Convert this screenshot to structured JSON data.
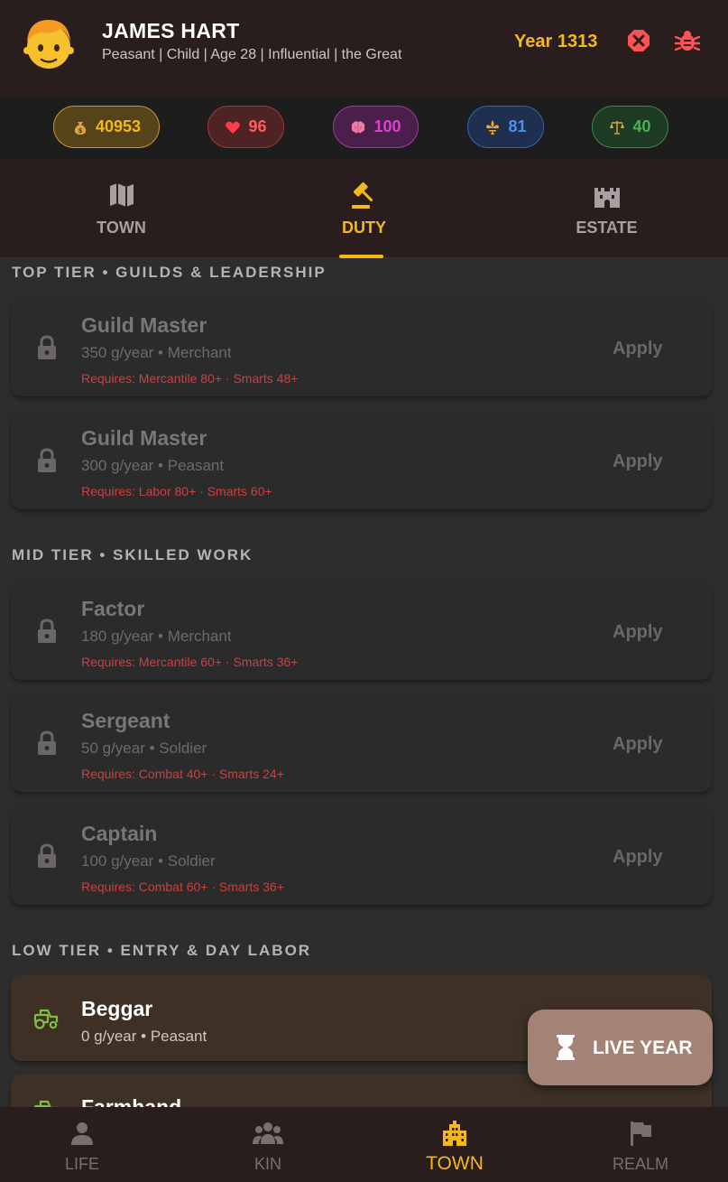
{
  "header": {
    "name": "JAMES HART",
    "subtitle": "Peasant | Child | Age 28 | Influential | the Great",
    "year": "Year 1313"
  },
  "stats": [
    {
      "icon": "money-bag-icon",
      "value": "40953",
      "color": "#f5b81c"
    },
    {
      "icon": "heart-icon",
      "value": "96",
      "color": "#ff5c5c"
    },
    {
      "icon": "brain-icon",
      "value": "100",
      "color": "#e53cd7"
    },
    {
      "icon": "fleur-de-lis-icon",
      "value": "81",
      "color": "#4e8ff0"
    },
    {
      "icon": "scales-icon",
      "value": "40",
      "color": "#4caf50"
    }
  ],
  "tabs": [
    {
      "label": "TOWN",
      "icon": "map-icon",
      "active": false
    },
    {
      "label": "DUTY",
      "icon": "gavel-icon",
      "active": true
    },
    {
      "label": "ESTATE",
      "icon": "castle-icon",
      "active": false
    }
  ],
  "sections": {
    "top": "TOP TIER • GUILDS & LEADERSHIP",
    "mid": "MID TIER • SKILLED WORK",
    "low": "LOW TIER • ENTRY & DAY LABOR"
  },
  "jobs": [
    {
      "title": "Guild Master",
      "pay": "350 g/year • Merchant",
      "req": "Requires: Mercantile 80+ · Smarts 48+",
      "action": "Apply"
    },
    {
      "title": "Guild Master",
      "pay": "300 g/year • Peasant",
      "req": "Requires: Labor 80+ · Smarts 60+",
      "action": "Apply"
    },
    {
      "title": "Factor",
      "pay": "180 g/year • Merchant",
      "req": "Requires: Mercantile 60+ · Smarts 36+",
      "action": "Apply"
    },
    {
      "title": "Sergeant",
      "pay": "50 g/year • Soldier",
      "req": "Requires: Combat 40+ · Smarts 24+",
      "action": "Apply"
    },
    {
      "title": "Captain",
      "pay": "100 g/year • Soldier",
      "req": "Requires: Combat 60+ · Smarts 36+",
      "action": "Apply"
    }
  ],
  "open_jobs": [
    {
      "title": "Beggar",
      "pay": "0 g/year • Peasant",
      "icon": "tractor-icon"
    },
    {
      "title": "Farmhand",
      "icon": "tractor-icon"
    }
  ],
  "fab": {
    "label": "LIVE YEAR"
  },
  "bottom_nav": [
    {
      "label": "LIFE",
      "icon": "person-icon",
      "active": false
    },
    {
      "label": "KIN",
      "icon": "people-icon",
      "active": false
    },
    {
      "label": "TOWN",
      "icon": "city-icon",
      "active": true
    },
    {
      "label": "REALM",
      "icon": "flag-icon",
      "active": false
    }
  ]
}
